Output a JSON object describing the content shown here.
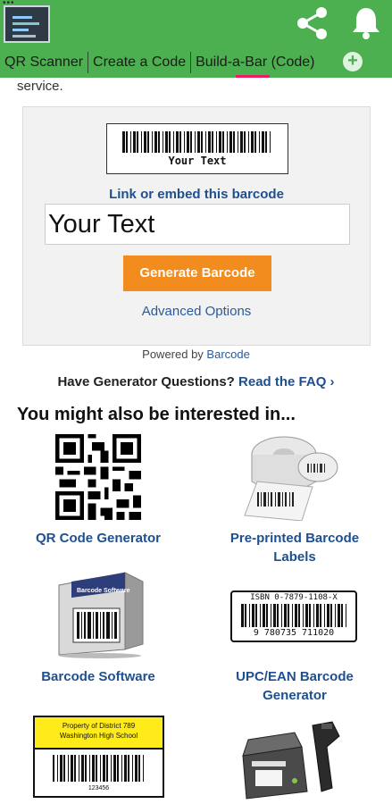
{
  "appbar": {
    "status_dots": "•••",
    "logo_icon": "app-logo",
    "share_icon": "share-icon",
    "bell_icon": "bell-icon",
    "plus_icon": "+",
    "tabs": [
      {
        "label": "QR Scanner",
        "active": false
      },
      {
        "label": "Create a Code",
        "active": false
      },
      {
        "label": "Build-a-Bar (Code)",
        "active": true
      }
    ],
    "colors": {
      "bar": "#4caf50",
      "active_indicator": "#e91e63"
    }
  },
  "page": {
    "cut_text": "service.",
    "generator": {
      "preview_text": "Your Text",
      "embed_link": "Link or embed this barcode",
      "input_value": "Your Text",
      "generate_button": "Generate Barcode",
      "advanced_options": "Advanced Options",
      "button_color": "#f28c1e"
    },
    "powered_by_prefix": "Powered by ",
    "powered_by_link": "Barcode",
    "faq_question": "Have Generator Questions? ",
    "faq_link": "Read the FAQ ›",
    "interested_title": "You might also be interested in...",
    "products": [
      {
        "label_lines": [
          "QR Code Generator"
        ]
      },
      {
        "label_lines": [
          "Pre-printed Barcode",
          "Labels"
        ]
      },
      {
        "label_lines": [
          "Barcode Software"
        ]
      },
      {
        "label_lines": [
          "UPC/EAN Barcode",
          "Generator"
        ]
      }
    ],
    "product_images": {
      "software_box_label": "Barcode Software",
      "upc_isbn_text": "ISBN 0-7879-1108-X",
      "upc_digits": "9 780735 711020",
      "asset_tag_line1": "Property of District 789",
      "asset_tag_line2": "Washington High School",
      "asset_tag_number": "123456"
    }
  }
}
